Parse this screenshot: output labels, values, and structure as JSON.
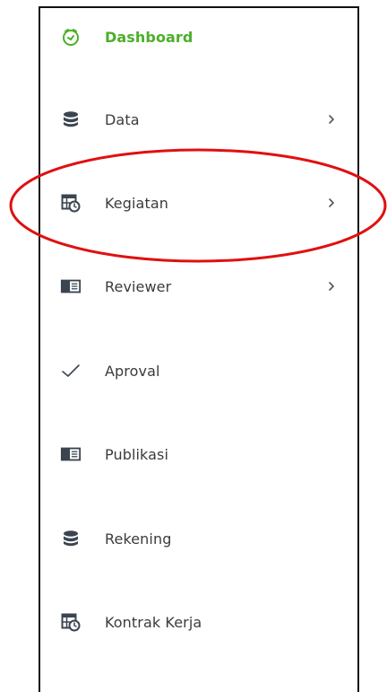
{
  "sidebar": {
    "items": [
      {
        "label": "Dashboard",
        "icon": "timer-icon",
        "active": true,
        "has_submenu": false
      },
      {
        "label": "Data",
        "icon": "database-icon",
        "active": false,
        "has_submenu": true
      },
      {
        "label": "Kegiatan",
        "icon": "calendar-clock-icon",
        "active": false,
        "has_submenu": true
      },
      {
        "label": "Reviewer",
        "icon": "book-icon",
        "active": false,
        "has_submenu": true
      },
      {
        "label": "Aproval",
        "icon": "check-icon",
        "active": false,
        "has_submenu": false
      },
      {
        "label": "Publikasi",
        "icon": "book-icon",
        "active": false,
        "has_submenu": false
      },
      {
        "label": "Rekening",
        "icon": "database-icon",
        "active": false,
        "has_submenu": false
      },
      {
        "label": "Kontrak Kerja",
        "icon": "calendar-clock-icon",
        "active": false,
        "has_submenu": false
      }
    ]
  },
  "colors": {
    "active_text": "#4caf2a",
    "text": "#3b3b3b",
    "icon": "#3b4550",
    "highlight_ring": "#e01010",
    "border": "#111111"
  }
}
